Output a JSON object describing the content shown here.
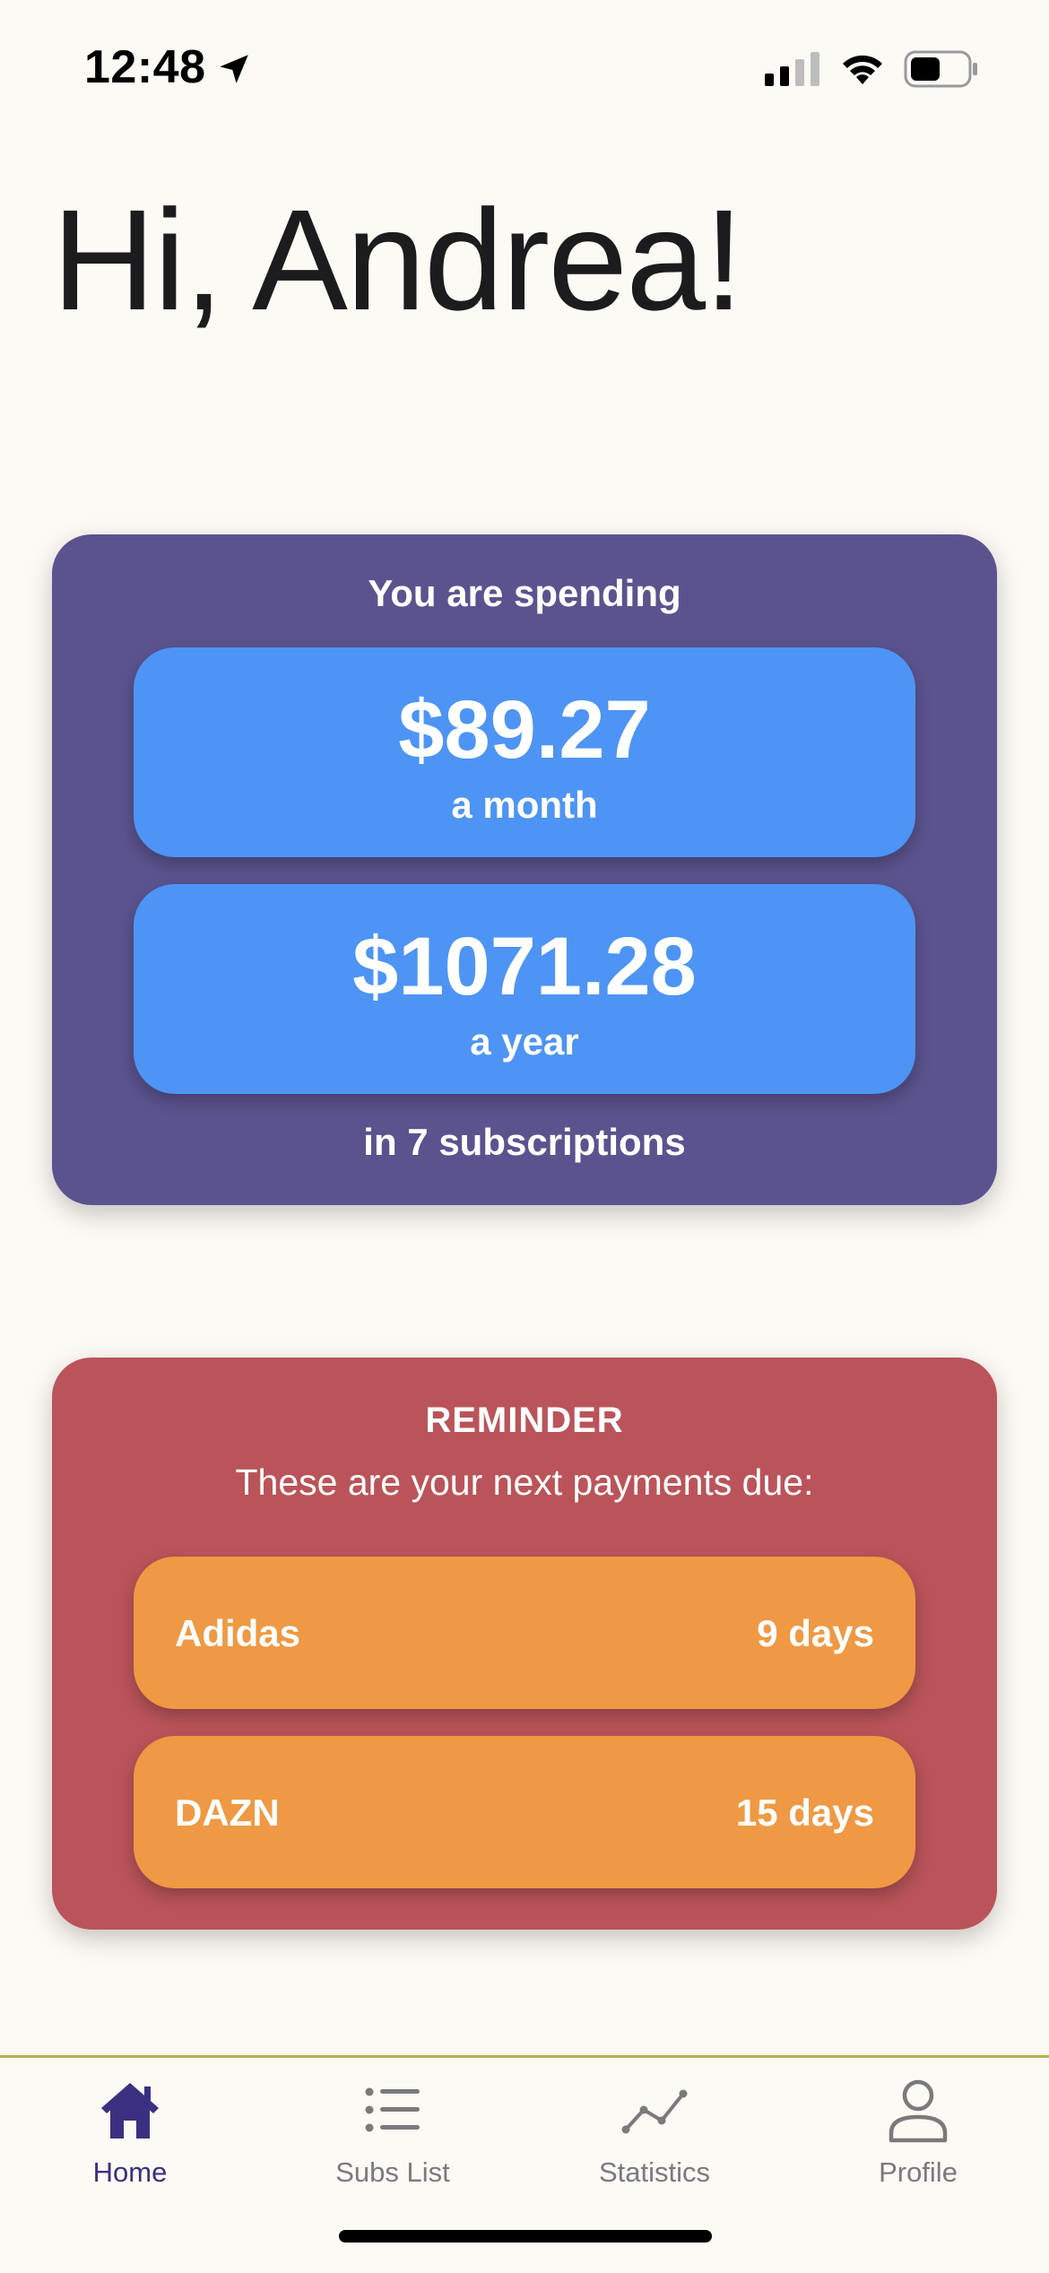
{
  "status_bar": {
    "time": "12:48",
    "icons": [
      "location-arrow-icon",
      "cellular-signal-icon",
      "wifi-icon",
      "battery-icon"
    ],
    "battery_level": 0.5
  },
  "greeting": "Hi, Andrea!",
  "spending": {
    "heading": "You are spending",
    "monthly_amount": "$89.27",
    "monthly_label": "a month",
    "yearly_amount": "$1071.28",
    "yearly_label": "a year",
    "subscriptions_text": "in 7 subscriptions"
  },
  "reminder": {
    "title": "REMINDER",
    "subtitle": "These are your next payments due:",
    "payments": [
      {
        "name": "Adidas",
        "due": "9 days"
      },
      {
        "name": "DAZN",
        "due": "15 days"
      }
    ]
  },
  "tab_bar": {
    "tabs": [
      {
        "label": "Home",
        "icon": "house-icon",
        "active": true
      },
      {
        "label": "Subs List",
        "icon": "list-icon",
        "active": false
      },
      {
        "label": "Statistics",
        "icon": "line-chart-icon",
        "active": false
      },
      {
        "label": "Profile",
        "icon": "person-icon",
        "active": false
      }
    ]
  },
  "colors": {
    "background": "#FDF9F5",
    "spending_card": "#5B538E",
    "amount_box": "#4D94F4",
    "reminder_card": "#BA545A",
    "payment_row": "#EF9944",
    "active_tab": "#3A3080",
    "inactive_tab": "#7A7A7A",
    "tab_bar_border": "#B8AE4E"
  }
}
